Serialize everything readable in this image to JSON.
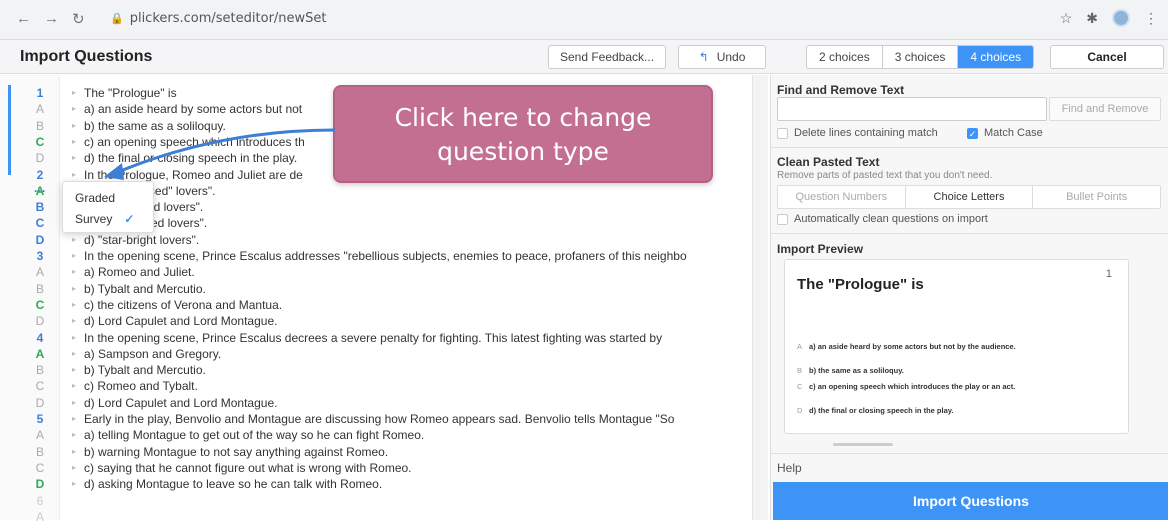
{
  "browser": {
    "url": "plickers.com/seteditor/newSet"
  },
  "header": {
    "title": "Import Questions",
    "feedback_label": "Send Feedback...",
    "undo_label": "Undo",
    "choices": [
      "2 choices",
      "3 choices",
      "4 choices"
    ],
    "active_choice": "4 choices",
    "cancel_label": "Cancel"
  },
  "editor": {
    "lines": [
      {
        "ln": "1",
        "kind": "num",
        "text": "The \"Prologue\" is"
      },
      {
        "ln": "A",
        "kind": "letter",
        "text": "a) an aside heard by some actors but not"
      },
      {
        "ln": "B",
        "kind": "letter",
        "text": "b) the same as a soliloquy."
      },
      {
        "ln": "C",
        "kind": "correct",
        "text": "c) an opening speech which introduces th"
      },
      {
        "ln": "D",
        "kind": "letter",
        "text": "d) the final or closing speech in the play."
      },
      {
        "ln": "2 ···",
        "kind": "num",
        "text": "In the Prologue, Romeo and Juliet are de"
      },
      {
        "ln": "A",
        "kind": "correct",
        "text": "a) \"star-crossed\" lovers\"."
      },
      {
        "ln": "B",
        "kind": "num",
        "text": "b) \"star-kissed lovers\"."
      },
      {
        "ln": "C",
        "kind": "num",
        "text": "c) \"star-aligned lovers\"."
      },
      {
        "ln": "D",
        "kind": "num",
        "text": "d) \"star-bright lovers\"."
      },
      {
        "ln": "3",
        "kind": "num",
        "text": "In the opening scene, Prince Escalus addresses \"rebellious subjects, enemies to peace, profaners of this neighbo"
      },
      {
        "ln": "A",
        "kind": "letter",
        "text": "a) Romeo and Juliet."
      },
      {
        "ln": "B",
        "kind": "letter",
        "text": "b) Tybalt and Mercutio."
      },
      {
        "ln": "C",
        "kind": "correct",
        "text": "c) the citizens of Verona and Mantua."
      },
      {
        "ln": "D",
        "kind": "letter",
        "text": "d) Lord Capulet and Lord Montague."
      },
      {
        "ln": "4",
        "kind": "num",
        "text": "In the opening scene, Prince Escalus decrees a severe penalty for fighting. This latest fighting was started by"
      },
      {
        "ln": "A",
        "kind": "correct",
        "text": "a) Sampson and Gregory."
      },
      {
        "ln": "B",
        "kind": "letter",
        "text": "b) Tybalt and Mercutio."
      },
      {
        "ln": "C",
        "kind": "letter",
        "text": "c) Romeo and Tybalt."
      },
      {
        "ln": "D",
        "kind": "letter",
        "text": "d) Lord Capulet and Lord Montague."
      },
      {
        "ln": "5",
        "kind": "num",
        "text": "Early in the play, Benvolio and Montague are discussing how Romeo appears sad. Benvolio tells Montague \"So"
      },
      {
        "ln": "A",
        "kind": "letter",
        "text": "a) telling Montague to get out of the way so he can fight Romeo."
      },
      {
        "ln": "B",
        "kind": "letter",
        "text": "b) warning Montague to not say anything against Romeo."
      },
      {
        "ln": "C",
        "kind": "letter",
        "text": "c) saying that he cannot figure out what is wrong with Romeo."
      },
      {
        "ln": "D",
        "kind": "correct",
        "text": "d) asking Montague to leave so he can talk with Romeo."
      },
      {
        "ln": "6",
        "kind": "faint",
        "text": ""
      },
      {
        "ln": "A",
        "kind": "faint",
        "text": ""
      }
    ]
  },
  "dropdown": {
    "graded": "Graded",
    "survey": "Survey",
    "selected": "Survey"
  },
  "callout": {
    "line1": "Click here to change",
    "line2": "question type"
  },
  "panel": {
    "find_title": "Find and Remove Text",
    "find_btn": "Find and Remove",
    "delete_lines": "Delete lines containing match",
    "match_case": "Match Case",
    "clean_title": "Clean Pasted Text",
    "clean_sub": "Remove parts of pasted text that you don't need.",
    "clean_opts": [
      "Question Numbers",
      "Choice Letters",
      "Bullet Points"
    ],
    "auto_clean": "Automatically clean questions on import",
    "preview_title": "Import Preview",
    "help": "Help",
    "import_btn": "Import Questions"
  },
  "preview": {
    "question": "The \"Prologue\" is",
    "number": "1",
    "choices": [
      {
        "letter": "A",
        "text": "a) an aside heard by some actors but not by the audience."
      },
      {
        "letter": "B",
        "text": "b) the same as a soliloquy."
      },
      {
        "letter": "C",
        "text": "c) an opening speech which introduces the play or an act."
      },
      {
        "letter": "D",
        "text": "d) the final or closing speech in the play."
      }
    ]
  },
  "colors": {
    "accent": "#3d94f6",
    "correct": "#2daa5a",
    "callout": "#c36f91"
  }
}
